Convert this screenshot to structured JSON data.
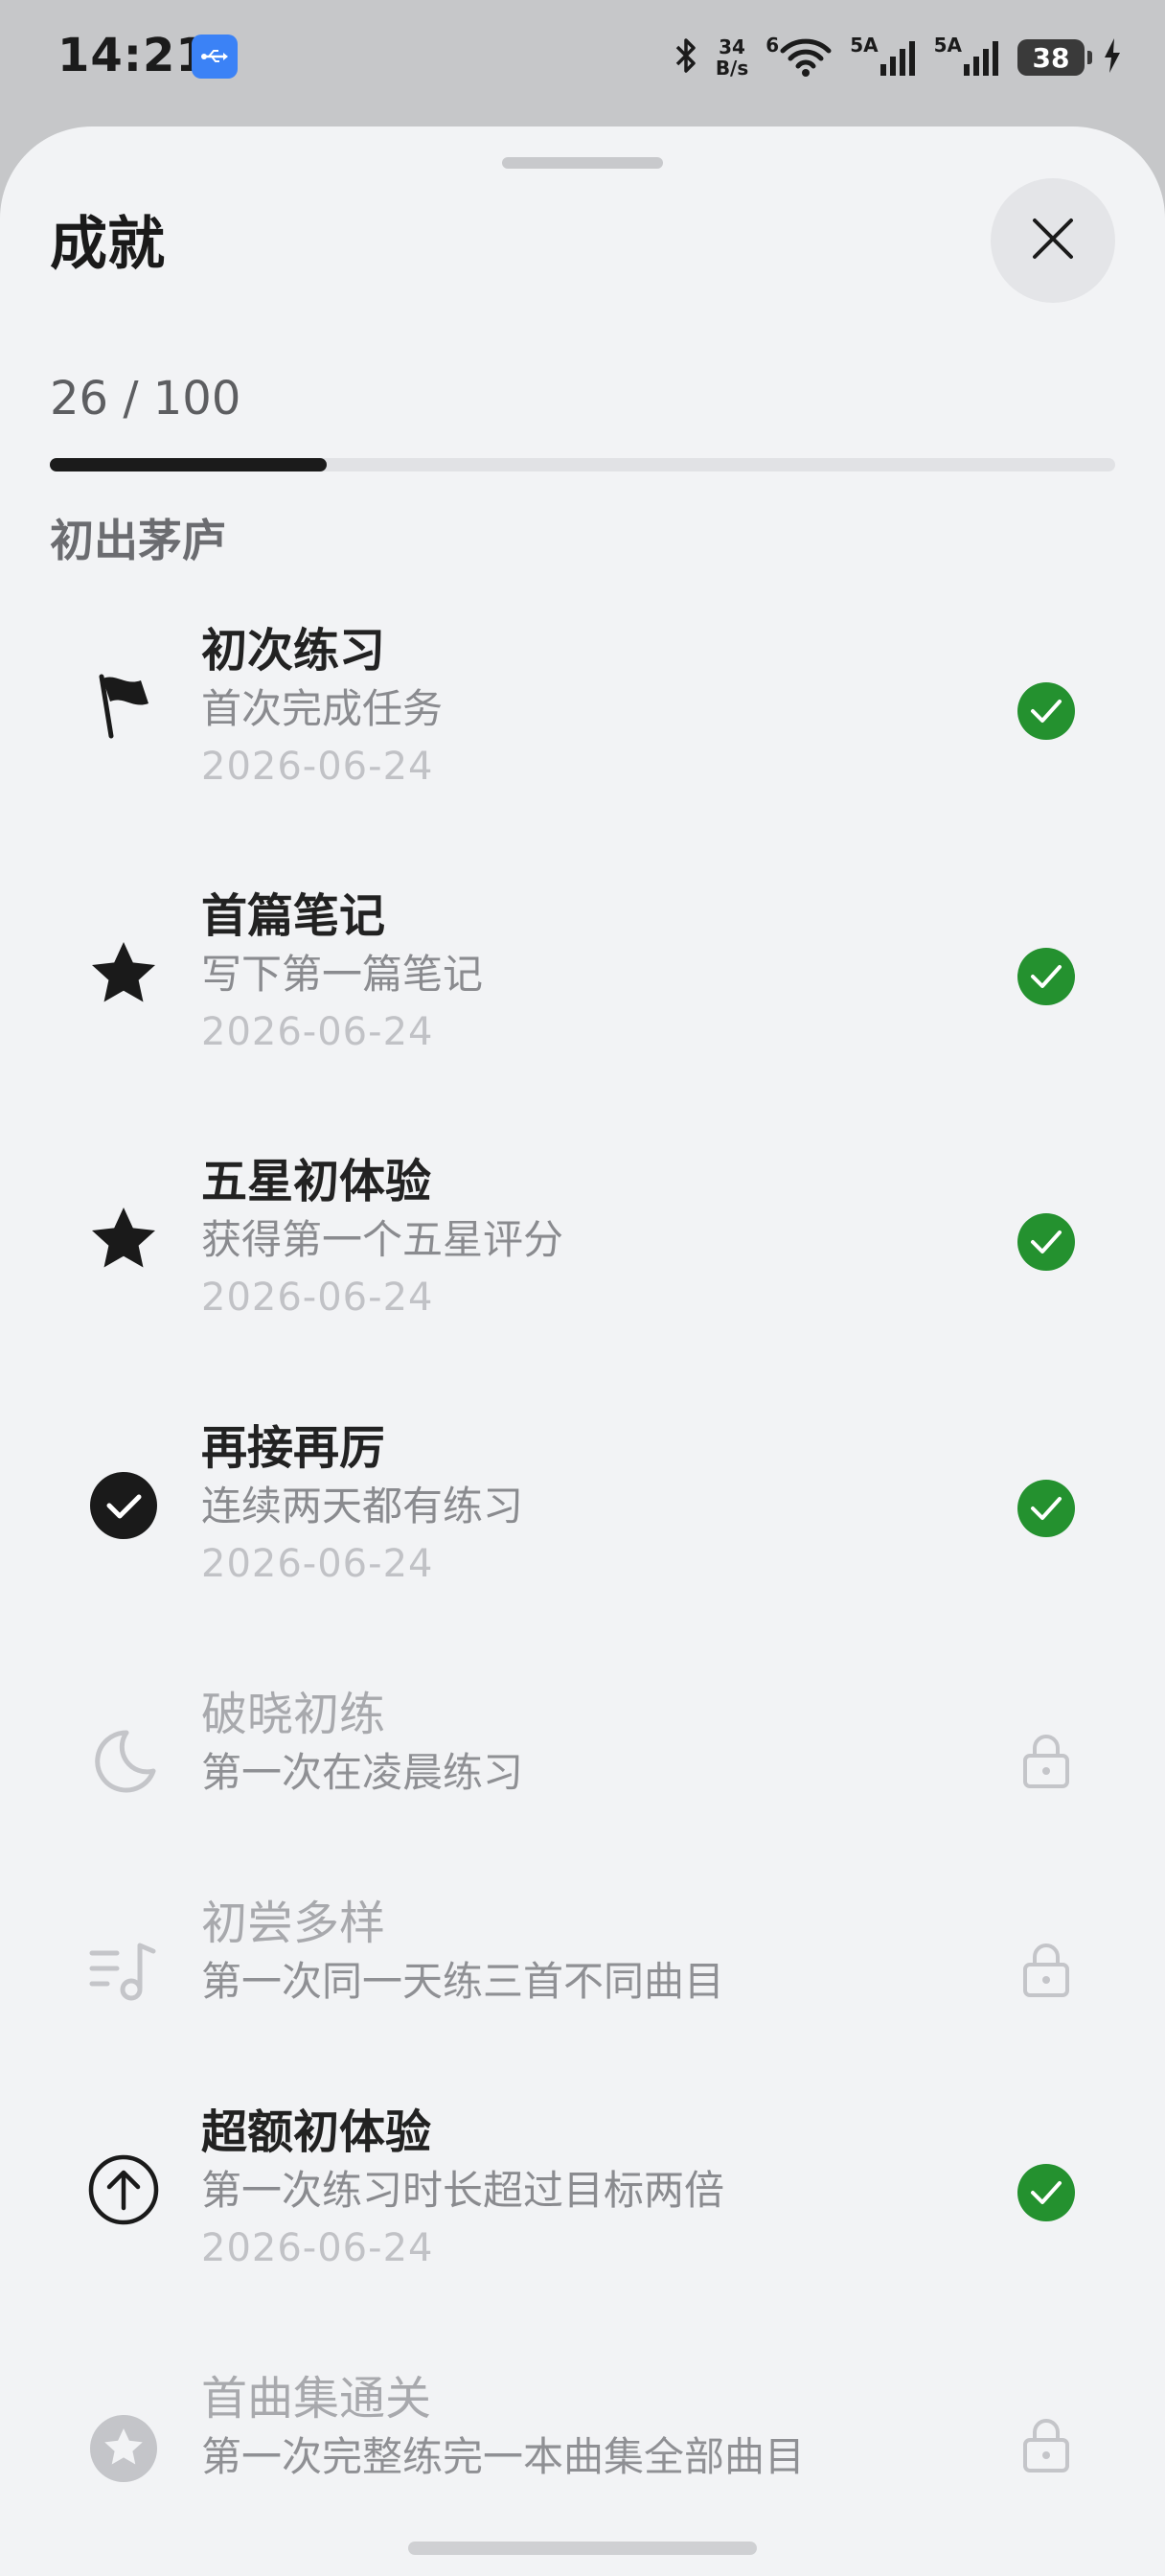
{
  "status_bar": {
    "time": "14:21",
    "net_speed_value": "34",
    "net_speed_unit": "B/s",
    "wifi_label": "6",
    "signal1_label": "5A",
    "signal2_label": "5A",
    "battery": "38"
  },
  "sheet": {
    "title": "成就",
    "progress_text": "26 / 100",
    "progress_value": 0.26,
    "section": "初出茅庐"
  },
  "achievements": [
    {
      "name": "初次练习",
      "desc": "首次完成任务",
      "date": "2026-06-24",
      "icon": "flag-icon",
      "unlocked": true
    },
    {
      "name": "首篇笔记",
      "desc": "写下第一篇笔记",
      "date": "2026-06-24",
      "icon": "star-icon",
      "unlocked": true
    },
    {
      "name": "五星初体验",
      "desc": "获得第一个五星评分",
      "date": "2026-06-24",
      "icon": "star-icon",
      "unlocked": true
    },
    {
      "name": "再接再厉",
      "desc": "连续两天都有练习",
      "date": "2026-06-24",
      "icon": "check-circle-icon",
      "unlocked": true
    },
    {
      "name": "破晓初练",
      "desc": "第一次在凌晨练习",
      "icon": "moon-icon",
      "unlocked": false
    },
    {
      "name": "初尝多样",
      "desc": "第一次同一天练三首不同曲目",
      "icon": "playlist-music-icon",
      "unlocked": false
    },
    {
      "name": "超额初体验",
      "desc": "第一次练习时长超过目标两倍",
      "date": "2026-06-24",
      "icon": "arrow-up-circle-icon",
      "unlocked": true
    },
    {
      "name": "首曲集通关",
      "desc": "第一次完整练完一本曲集全部曲目",
      "icon": "star-circle-icon",
      "unlocked": false
    }
  ],
  "colors": {
    "unlocked_badge": "#24912f",
    "progress_fill": "#1b1b1b",
    "locked_icon": "#c4c5c9"
  }
}
